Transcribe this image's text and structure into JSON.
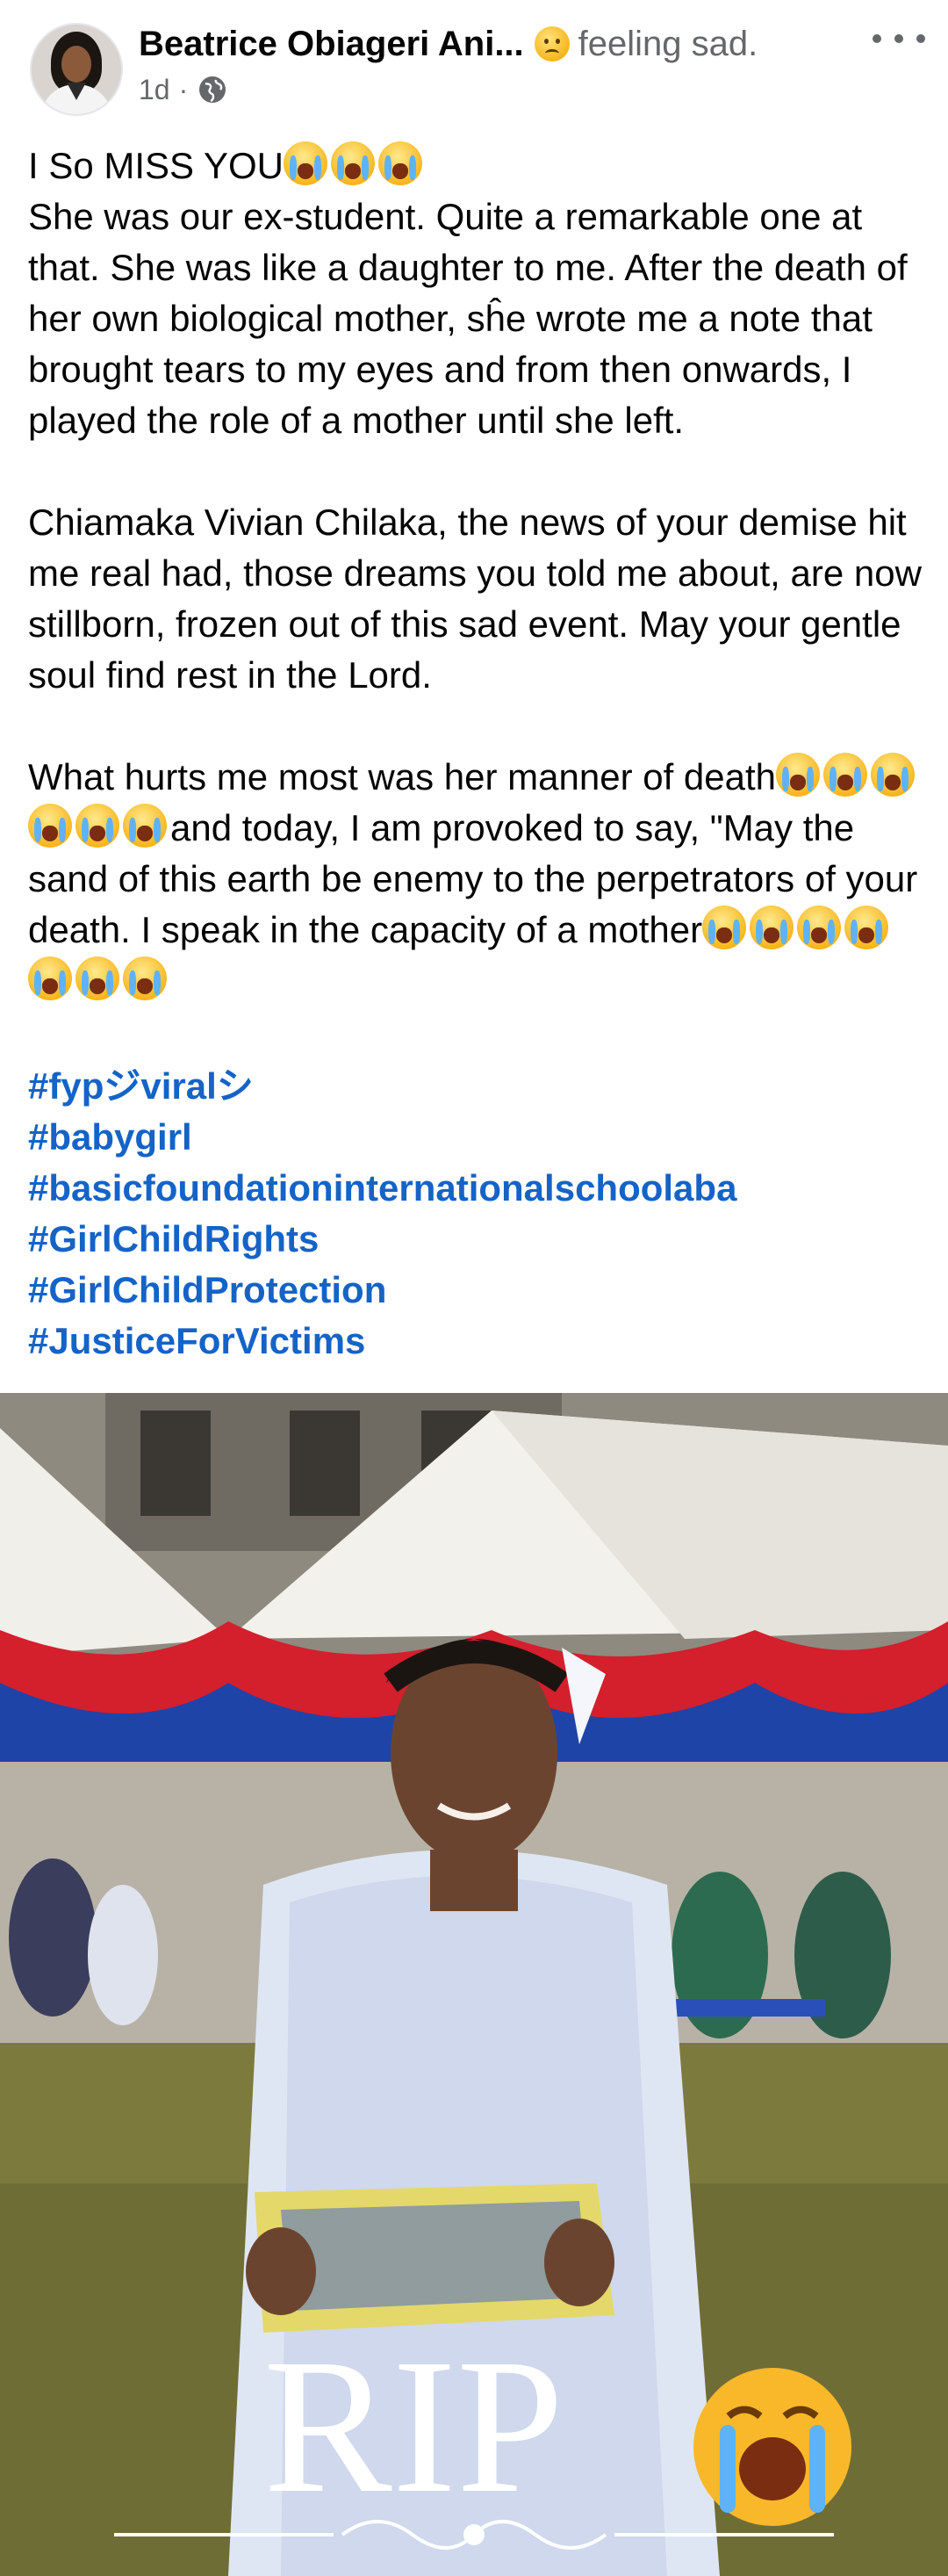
{
  "post": {
    "author": "Beatrice Obiageri Ani...",
    "feeling": "feeling sad.",
    "feeling_icon": "sad-face-emoji-icon",
    "time": "1d",
    "separator": "·",
    "privacy_icon": "globe-icon",
    "more_icon": "more-options-icon"
  },
  "body": {
    "line1": "I So MISS YOU",
    "para1": "She was our ex-student. Quite a remarkable one at that. She was like a daughter to me. After the death of her own biological mother, sĥe wrote me a note that brought tears to my eyes and from then onwards,  I played the role of a mother until she left.",
    "para2": "Chiamaka Vivian Chilaka, the news of your demise hit me real had, those dreams you told me about, are now stillborn, frozen out of this sad event. May your gentle soul find rest in the Lord.",
    "para3a": "What hurts me most was her manner of death",
    "para3b": "and today, I am provoked to say, \"May the sand of this earth be enemy to the perpetrators of your death. I speak in the capacity of a mother",
    "emoji_icon": "loudly-crying-face-icon"
  },
  "hashtags": [
    "#fypジviralシ",
    "#babygirl",
    "#basicfoundationinternationalschoolaba",
    "#GirlChildRights",
    "#GirlChildProtection",
    "#JusticeForVictims"
  ],
  "photo": {
    "overlay_text": "RIP",
    "overlay_icon": "loudly-crying-face-icon"
  },
  "colors": {
    "hashtag": "#1563c7",
    "secondary_text": "#65676b",
    "tent_red": "#d41f2c",
    "tent_blue": "#1f44a8"
  }
}
